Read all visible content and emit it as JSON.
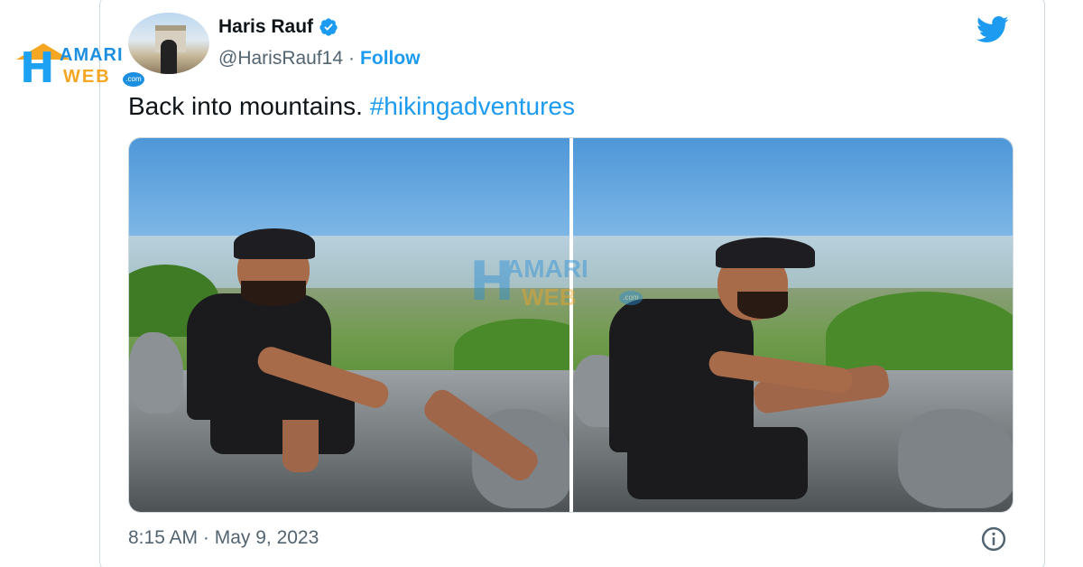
{
  "watermark": {
    "line1": "AMARI",
    "line2": "WEB",
    "suffix": ".com"
  },
  "tweet": {
    "author_name": "Haris Rauf",
    "handle": "@HarisRauf14",
    "separator": "·",
    "follow_label": "Follow",
    "text": "Back into mountains. ",
    "hashtag": "#hikingadventures",
    "timestamp": "8:15 AM · May 9, 2023",
    "verified": true
  },
  "colors": {
    "link": "#1d9bf0",
    "verified": "#1d9bf0",
    "secondary_text": "#536471"
  },
  "icons": [
    "verified-badge-icon",
    "twitter-bird-icon",
    "info-icon"
  ]
}
